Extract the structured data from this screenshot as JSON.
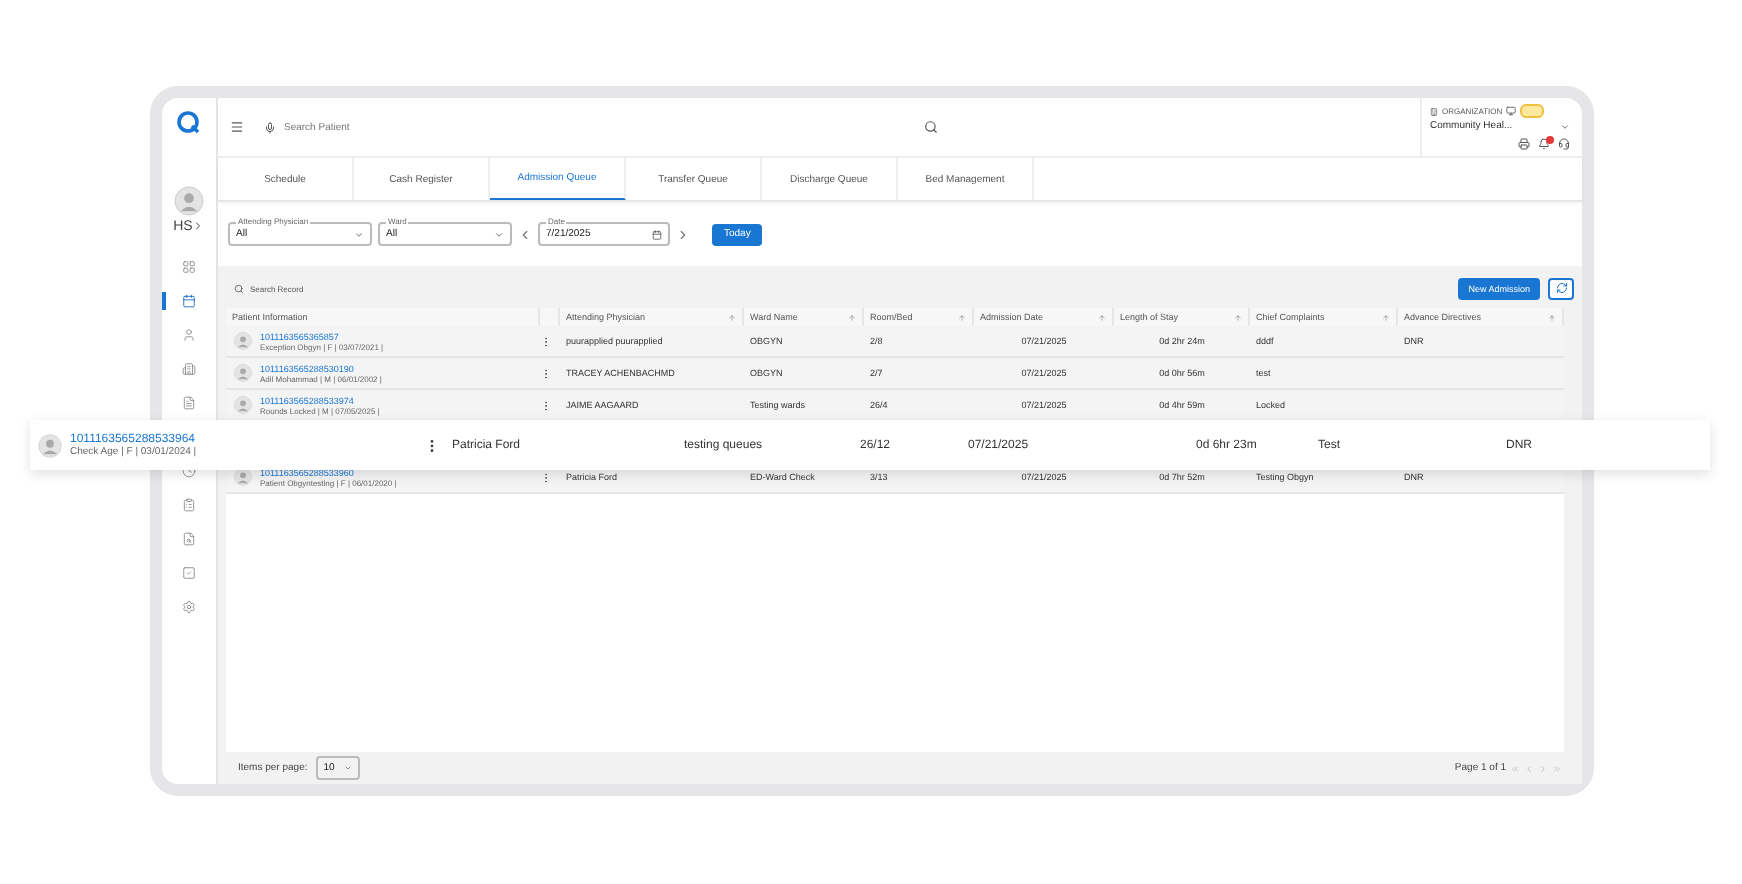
{
  "sidebar": {
    "initials": "HS",
    "items": [
      {
        "kind": "grid",
        "selected": false
      },
      {
        "kind": "calendar",
        "selected": true
      },
      {
        "kind": "person",
        "selected": false
      },
      {
        "kind": "building",
        "selected": false
      },
      {
        "kind": "document",
        "selected": false
      },
      {
        "kind": "hidden"
      },
      {
        "kind": "clock",
        "selected": false
      },
      {
        "kind": "clipboard",
        "selected": false
      },
      {
        "kind": "search-doc",
        "selected": false
      },
      {
        "kind": "check-doc",
        "selected": false
      },
      {
        "kind": "gear",
        "selected": false
      }
    ]
  },
  "topbar": {
    "search": {
      "placeholder": "Search Patient"
    },
    "organization_label": "ORGANIZATION",
    "organization_name": "Community Heal..."
  },
  "tabs": [
    {
      "label": "Schedule",
      "selected": false
    },
    {
      "label": "Cash Register",
      "selected": false
    },
    {
      "label": "Admission Queue",
      "selected": true
    },
    {
      "label": "Transfer Queue",
      "selected": false
    },
    {
      "label": "Discharge Queue",
      "selected": false
    },
    {
      "label": "Bed Management",
      "selected": false
    }
  ],
  "filters": {
    "attending_physician": {
      "label": "Attending Physician",
      "value": "All"
    },
    "ward": {
      "label": "Ward",
      "value": "All"
    },
    "date": {
      "label": "Date",
      "value": "7/21/2025"
    },
    "today_button": "Today"
  },
  "search_record": {
    "placeholder": "Search Record"
  },
  "new_admission_button": "New Admission",
  "table": {
    "columns": [
      {
        "label": "Patient Information",
        "sortable": false
      },
      {
        "label": "Attending Physician",
        "sortable": true
      },
      {
        "label": "Ward Name",
        "sortable": true
      },
      {
        "label": "Room/Bed",
        "sortable": true
      },
      {
        "label": "Admission Date",
        "sortable": true
      },
      {
        "label": "Length of Stay",
        "sortable": true
      },
      {
        "label": "Chief Complaints",
        "sortable": true
      },
      {
        "label": "Advance Directives",
        "sortable": true
      }
    ],
    "rows": [
      {
        "lifted": false,
        "id": "1011163565365857",
        "details": "Exception Obgyn | F | 03/07/2021 |",
        "physician": "puurapplied puurapplied",
        "ward": "OBGYN",
        "room": "2/8",
        "admission_date": "07/21/2025",
        "length_of_stay": "0d 2hr 24m",
        "complaints": "dddf",
        "directives": "DNR"
      },
      {
        "lifted": false,
        "id": "1011163565288530190",
        "details": "Adil Mohammad | M | 06/01/2002 |",
        "physician": "TRACEY ACHENBACHMD",
        "ward": "OBGYN",
        "room": "2/7",
        "admission_date": "07/21/2025",
        "length_of_stay": "0d 0hr 56m",
        "complaints": "test"
      },
      {
        "lifted": false,
        "id": "1011163565288533974",
        "details": "Rounds Locked | M | 07/05/2025 |",
        "physician": "JAIME AAGAARD",
        "ward": "Testing wards",
        "room": "26/4",
        "admission_date": "07/21/2025",
        "length_of_stay": "0d 4hr 59m",
        "complaints": "Locked"
      },
      {
        "lifted": true,
        "id": "1011163565288533964",
        "details": "Check Age | F | 03/01/2024 |",
        "physician": "Patricia Ford",
        "ward": "testing queues",
        "room": "26/12",
        "admission_date": "07/21/2025",
        "length_of_stay": "0d 6hr 23m",
        "complaints": "Test",
        "directives": "DNR"
      },
      {
        "lifted": false,
        "id": "1011163565288533960",
        "details": "Patient Obgyntesting | F | 06/01/2020 |",
        "physician": "Patricia Ford",
        "ward": "ED-Ward Check",
        "room": "3/13",
        "admission_date": "07/21/2025",
        "length_of_stay": "0d 7hr 52m",
        "complaints": "Testing Obgyn",
        "directives": "DNR"
      }
    ]
  },
  "pagination": {
    "items_per_page_label": "Items per page:",
    "items_per_page": "10",
    "page_label": "Page 1 of 1"
  }
}
